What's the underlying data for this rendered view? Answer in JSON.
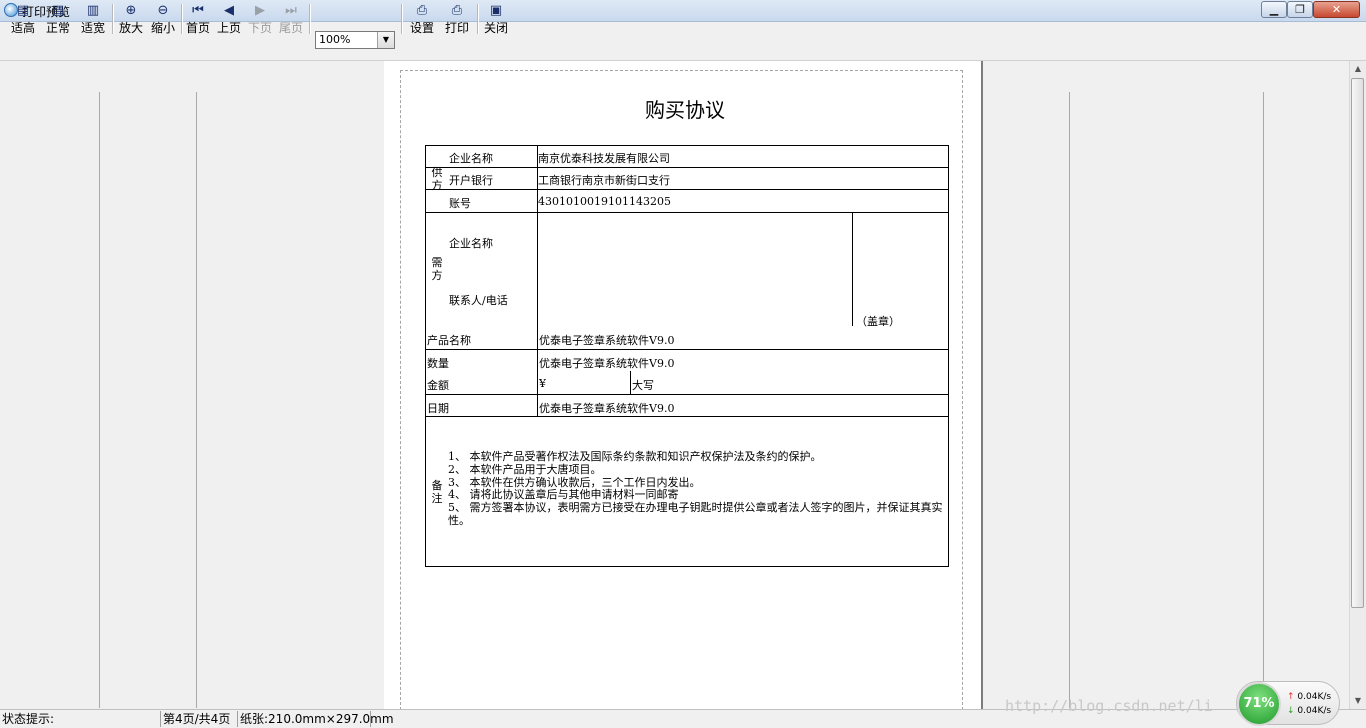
{
  "window": {
    "title": "打印预览"
  },
  "toolbar": {
    "fit_height": "适高",
    "normal": "正常",
    "fit_width": "适宽",
    "zoom_in": "放大",
    "zoom_out": "缩小",
    "first_page": "首页",
    "prev_page": "上页",
    "next_page": "下页",
    "last_page": "尾页",
    "zoom_value": "100%",
    "settings": "设置",
    "print": "打印",
    "close": "关闭"
  },
  "document": {
    "title": "购买协议",
    "supplier_label": "供方",
    "company_name_label": "企业名称",
    "company_name": "南京优泰科技发展有限公司",
    "bank_label": "开户银行",
    "bank": "工商银行南京市新街口支行",
    "account_label": "账号",
    "account": "4301010019101143205",
    "buyer_label": "需方",
    "buyer_company_label": "企业名称",
    "buyer_contact_label": "联系人/电话",
    "seal_label": "（盖章）",
    "product_label": "产品名称",
    "product": "优泰电子签章系统软件V9.0",
    "quantity_label": "数量",
    "quantity": "优泰电子签章系统软件V9.0",
    "amount_label": "金额",
    "amount_symbol": "¥",
    "amount_caps_label": "大写",
    "date_label": "日期",
    "date": "优泰电子签章系统软件V9.0",
    "remarks_label": "备注",
    "remarks": [
      "1、 本软件产品受著作权法及国际条约条款和知识产权保护法及条约的保护。",
      "2、 本软件产品用于大唐项目。",
      "3、 本软件在供方确认收款后，三个工作日内发出。",
      "4、 请将此协议盖章后与其他申请材料一同邮寄",
      "5、 需方签署本协议，表明需方已接受在办理电子钥匙时提供公章或者法人签字的图片，并保证其真实性。"
    ]
  },
  "status_bar": {
    "hint": "状态提示:",
    "page": "第4页/共4页",
    "paper": "纸张:210.0mm×297.0mm"
  },
  "overlay": {
    "watermark": "http://blog.csdn.net/li",
    "monitor_percent": "71%",
    "upload_speed": "0.04K/s",
    "download_speed": "0.04K/s"
  },
  "icons": {
    "app": "app-icon",
    "minimize": "minimize-icon",
    "maximize": "maximize-icon",
    "close": "close-icon"
  },
  "colors": {
    "close_button": "#c74830",
    "monitor": "#1f9a2b"
  }
}
